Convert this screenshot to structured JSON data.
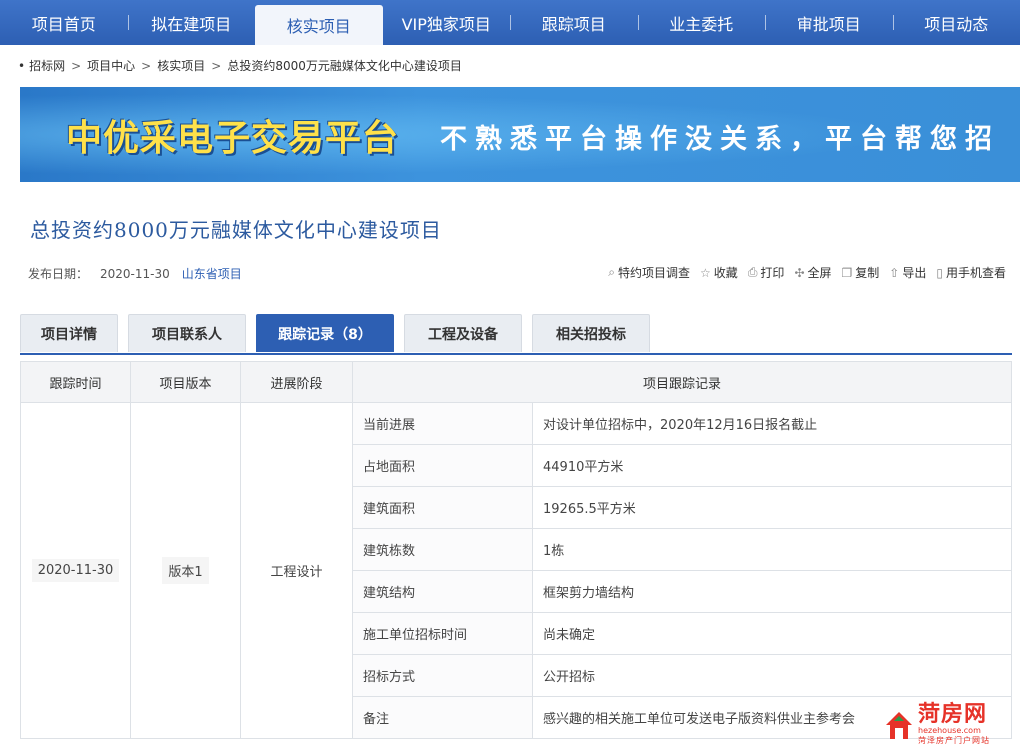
{
  "nav": {
    "items": [
      "项目首页",
      "拟在建项目",
      "核实项目",
      "VIP独家项目",
      "跟踪项目",
      "业主委托",
      "审批项目",
      "项目动态"
    ],
    "active_index": 2
  },
  "breadcrumb": {
    "items": [
      "招标网",
      "项目中心",
      "核实项目",
      "总投资约8000万元融媒体文化中心建设项目"
    ]
  },
  "banner": {
    "brand": "中优采电子交易平台",
    "slogan": "不熟悉平台操作没关系，平台帮您招"
  },
  "project": {
    "title": "总投资约8000万元融媒体文化中心建设项目",
    "publish_label": "发布日期：",
    "publish_date": "2020-11-30",
    "region": "山东省项目"
  },
  "tools": [
    {
      "icon": "search-icon",
      "label": "特约项目调查"
    },
    {
      "icon": "star-icon",
      "label": "收藏"
    },
    {
      "icon": "printer-icon",
      "label": "打印"
    },
    {
      "icon": "fullscreen-icon",
      "label": "全屏"
    },
    {
      "icon": "copy-icon",
      "label": "复制"
    },
    {
      "icon": "export-icon",
      "label": "导出"
    },
    {
      "icon": "phone-icon",
      "label": "用手机查看"
    }
  ],
  "tabs": [
    {
      "label": "项目详情"
    },
    {
      "label": "项目联系人"
    },
    {
      "label": "跟踪记录（8）"
    },
    {
      "label": "工程及设备"
    },
    {
      "label": "相关招投标"
    }
  ],
  "active_tab": 2,
  "table": {
    "headers": [
      "跟踪时间",
      "项目版本",
      "进展阶段",
      "项目跟踪记录"
    ],
    "track_time": "2020-11-30",
    "version": "版本1",
    "stage": "工程设计",
    "rows": [
      {
        "field": "当前进展",
        "value": "对设计单位招标中，2020年12月16日报名截止"
      },
      {
        "field": "占地面积",
        "value": "44910平方米"
      },
      {
        "field": "建筑面积",
        "value": "19265.5平方米"
      },
      {
        "field": "建筑栋数",
        "value": "1栋"
      },
      {
        "field": "建筑结构",
        "value": "框架剪力墙结构"
      },
      {
        "field": "施工单位招标时间",
        "value": "尚未确定"
      },
      {
        "field": "招标方式",
        "value": "公开招标"
      },
      {
        "field": "备注",
        "value": "感兴趣的相关施工单位可发送电子版资料供业主参考会"
      }
    ]
  },
  "watermark": {
    "name": "菏房网",
    "url": "hezehouse.com",
    "sub": "菏泽房产门户网站"
  },
  "colors": {
    "nav_blue": "#2d5fb3",
    "title_blue": "#2c5a9f",
    "brand_yellow": "#ffe14a",
    "watermark_red": "#e63228"
  }
}
